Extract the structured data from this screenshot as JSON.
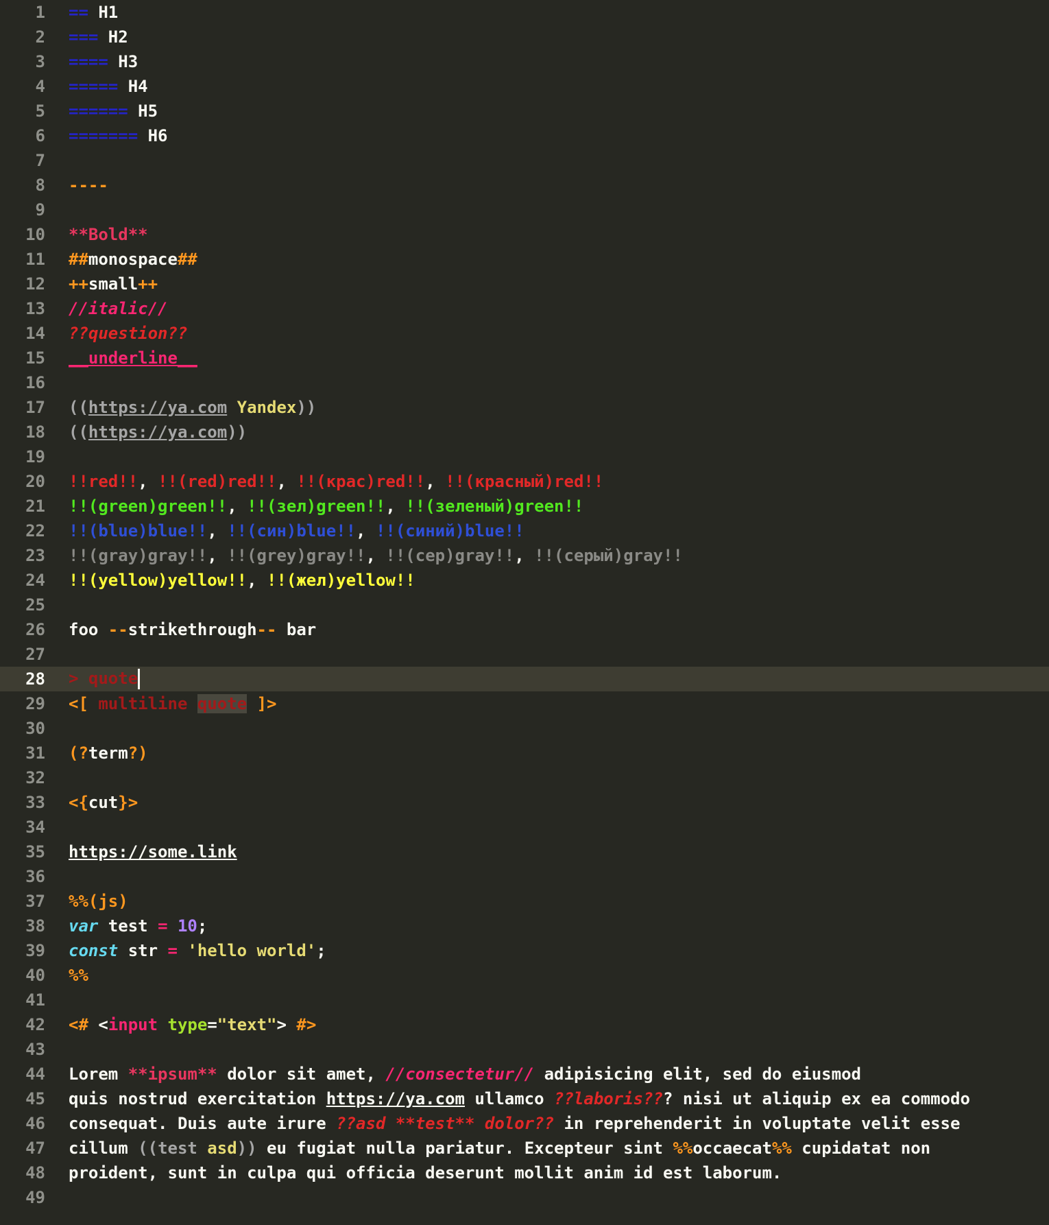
{
  "editor": {
    "active_line": 28,
    "line_numbers": [
      "1",
      "2",
      "3",
      "4",
      "5",
      "6",
      "7",
      "8",
      "9",
      "10",
      "11",
      "12",
      "13",
      "14",
      "15",
      "16",
      "17",
      "18",
      "19",
      "20",
      "21",
      "22",
      "23",
      "24",
      "25",
      "26",
      "27",
      "28",
      "29",
      "30",
      "31",
      "32",
      "33",
      "34",
      "35",
      "36",
      "37",
      "38",
      "39",
      "40",
      "41",
      "42",
      "43",
      "44",
      "45",
      "46",
      "47",
      "48",
      "49"
    ],
    "lines": [
      [
        {
          "t": "==",
          "c": "hm"
        },
        {
          "t": " H1",
          "c": "ht"
        }
      ],
      [
        {
          "t": "===",
          "c": "hm"
        },
        {
          "t": " H2",
          "c": "ht"
        }
      ],
      [
        {
          "t": "====",
          "c": "hm"
        },
        {
          "t": " H3",
          "c": "ht"
        }
      ],
      [
        {
          "t": "=====",
          "c": "hm"
        },
        {
          "t": " H4",
          "c": "ht"
        }
      ],
      [
        {
          "t": "======",
          "c": "hm"
        },
        {
          "t": " H5",
          "c": "ht"
        }
      ],
      [
        {
          "t": "=======",
          "c": "hm"
        },
        {
          "t": " H6",
          "c": "ht"
        }
      ],
      [],
      [
        {
          "t": "----",
          "c": "or"
        }
      ],
      [],
      [
        {
          "t": "**Bold**",
          "c": "pkb"
        }
      ],
      [
        {
          "t": "##",
          "c": "or"
        },
        {
          "t": "monospace",
          "c": ""
        },
        {
          "t": "##",
          "c": "or"
        }
      ],
      [
        {
          "t": "++",
          "c": "or"
        },
        {
          "t": "small",
          "c": ""
        },
        {
          "t": "++",
          "c": "or"
        }
      ],
      [
        {
          "t": "//italic//",
          "c": "pk it"
        }
      ],
      [
        {
          "t": "??question??",
          "c": "rd it"
        }
      ],
      [
        {
          "t": "__underline__",
          "c": "pk ul"
        }
      ],
      [],
      [
        {
          "t": "((",
          "c": "gy"
        },
        {
          "t": "https://ya.com",
          "c": "gy ul"
        },
        {
          "t": " ",
          "c": ""
        },
        {
          "t": "Yandex",
          "c": "yl2"
        },
        {
          "t": "))",
          "c": "gy"
        }
      ],
      [
        {
          "t": "((",
          "c": "gy"
        },
        {
          "t": "https://ya.com",
          "c": "gy ul"
        },
        {
          "t": "))",
          "c": "gy"
        }
      ],
      [],
      [
        {
          "t": "!!red!!",
          "c": "rd"
        },
        {
          "t": ", ",
          "c": ""
        },
        {
          "t": "!!(red)red!!",
          "c": "rd"
        },
        {
          "t": ", ",
          "c": ""
        },
        {
          "t": "!!(крас)red!!",
          "c": "rd"
        },
        {
          "t": ", ",
          "c": ""
        },
        {
          "t": "!!(красный)red!!",
          "c": "rd"
        }
      ],
      [
        {
          "t": "!!(green)green!!",
          "c": "gr"
        },
        {
          "t": ", ",
          "c": ""
        },
        {
          "t": "!!(зел)green!!",
          "c": "gr"
        },
        {
          "t": ", ",
          "c": ""
        },
        {
          "t": "!!(зеленый)green!!",
          "c": "gr"
        }
      ],
      [
        {
          "t": "!!(blue)blue!!",
          "c": "bl"
        },
        {
          "t": ", ",
          "c": ""
        },
        {
          "t": "!!(син)blue!!",
          "c": "bl"
        },
        {
          "t": ", ",
          "c": ""
        },
        {
          "t": "!!(синий)blue!!",
          "c": "bl"
        }
      ],
      [
        {
          "t": "!!(gray)gray!!",
          "c": "gy2"
        },
        {
          "t": ", ",
          "c": ""
        },
        {
          "t": "!!(grey)gray!!",
          "c": "gy2"
        },
        {
          "t": ", ",
          "c": ""
        },
        {
          "t": "!!(сер)gray!!",
          "c": "gy2"
        },
        {
          "t": ", ",
          "c": ""
        },
        {
          "t": "!!(серый)gray!!",
          "c": "gy2"
        }
      ],
      [
        {
          "t": "!!(yellow)yellow!!",
          "c": "yl"
        },
        {
          "t": ", ",
          "c": ""
        },
        {
          "t": "!!(жел)yellow!!",
          "c": "yl"
        }
      ],
      [],
      [
        {
          "t": "foo ",
          "c": ""
        },
        {
          "t": "--",
          "c": "or"
        },
        {
          "t": "strikethrough",
          "c": ""
        },
        {
          "t": "--",
          "c": "or"
        },
        {
          "t": " bar",
          "c": ""
        }
      ],
      [],
      [
        {
          "t": "> quote",
          "c": "qr"
        }
      ],
      [
        {
          "t": "<[",
          "c": "or"
        },
        {
          "t": " multiline ",
          "c": "qr"
        },
        {
          "t": "quote",
          "c": "qr qbg"
        },
        {
          "t": " ",
          "c": ""
        },
        {
          "t": "]>",
          "c": "or"
        }
      ],
      [],
      [
        {
          "t": "(?",
          "c": "or"
        },
        {
          "t": "term",
          "c": ""
        },
        {
          "t": "?)",
          "c": "or"
        }
      ],
      [],
      [
        {
          "t": "<{",
          "c": "or"
        },
        {
          "t": "cut",
          "c": ""
        },
        {
          "t": "}>",
          "c": "or"
        }
      ],
      [],
      [
        {
          "t": "https://some.link",
          "c": "ul"
        }
      ],
      [],
      [
        {
          "t": "%%(js)",
          "c": "or"
        }
      ],
      [
        {
          "t": "var",
          "c": "cy it"
        },
        {
          "t": " test ",
          "c": ""
        },
        {
          "t": "=",
          "c": "pk"
        },
        {
          "t": " ",
          "c": ""
        },
        {
          "t": "10",
          "c": "pu"
        },
        {
          "t": ";",
          "c": ""
        }
      ],
      [
        {
          "t": "const",
          "c": "cy it"
        },
        {
          "t": " str ",
          "c": ""
        },
        {
          "t": "=",
          "c": "pk"
        },
        {
          "t": " ",
          "c": ""
        },
        {
          "t": "'hello world'",
          "c": "yl2"
        },
        {
          "t": ";",
          "c": ""
        }
      ],
      [
        {
          "t": "%%",
          "c": "or"
        }
      ],
      [],
      [
        {
          "t": "<#",
          "c": "or"
        },
        {
          "t": " <",
          "c": ""
        },
        {
          "t": "input",
          "c": "pk"
        },
        {
          "t": " ",
          "c": ""
        },
        {
          "t": "type",
          "c": "lime"
        },
        {
          "t": "=",
          "c": ""
        },
        {
          "t": "\"text\"",
          "c": "yl2"
        },
        {
          "t": "> ",
          "c": ""
        },
        {
          "t": "#>",
          "c": "or"
        }
      ],
      [],
      [
        {
          "t": "Lorem ",
          "c": ""
        },
        {
          "t": "**ipsum**",
          "c": "pkb"
        },
        {
          "t": " dolor sit amet, ",
          "c": ""
        },
        {
          "t": "//consectetur//",
          "c": "pk it"
        },
        {
          "t": " adipisicing elit, sed do eiusmod",
          "c": ""
        }
      ],
      [
        {
          "t": "quis nostrud exercitation ",
          "c": ""
        },
        {
          "t": "https://ya.com",
          "c": "ul"
        },
        {
          "t": " ullamco ",
          "c": ""
        },
        {
          "t": "??laboris??",
          "c": "rd it"
        },
        {
          "t": "? nisi ut aliquip ex ea commodo",
          "c": ""
        }
      ],
      [
        {
          "t": "consequat. Duis aute irure ",
          "c": ""
        },
        {
          "t": "??asd **test** dolor??",
          "c": "rd it"
        },
        {
          "t": " in reprehenderit in voluptate velit esse",
          "c": ""
        }
      ],
      [
        {
          "t": "cillum ",
          "c": ""
        },
        {
          "t": "((",
          "c": "gy"
        },
        {
          "t": "test",
          "c": "gy"
        },
        {
          "t": " asd",
          "c": "yl2"
        },
        {
          "t": "))",
          "c": "gy"
        },
        {
          "t": " eu fugiat nulla pariatur. Excepteur sint ",
          "c": ""
        },
        {
          "t": "%%",
          "c": "or"
        },
        {
          "t": "occaecat",
          "c": ""
        },
        {
          "t": "%%",
          "c": "or"
        },
        {
          "t": " cupidatat non",
          "c": ""
        }
      ],
      [
        {
          "t": "proident, sunt in culpa qui officia deserunt mollit anim id est laborum.",
          "c": ""
        }
      ],
      []
    ]
  },
  "colors": {
    "background": "#272822",
    "active_line": "#3e3d32",
    "gutter_text": "#8f908a",
    "text": "#f8f8f2"
  }
}
